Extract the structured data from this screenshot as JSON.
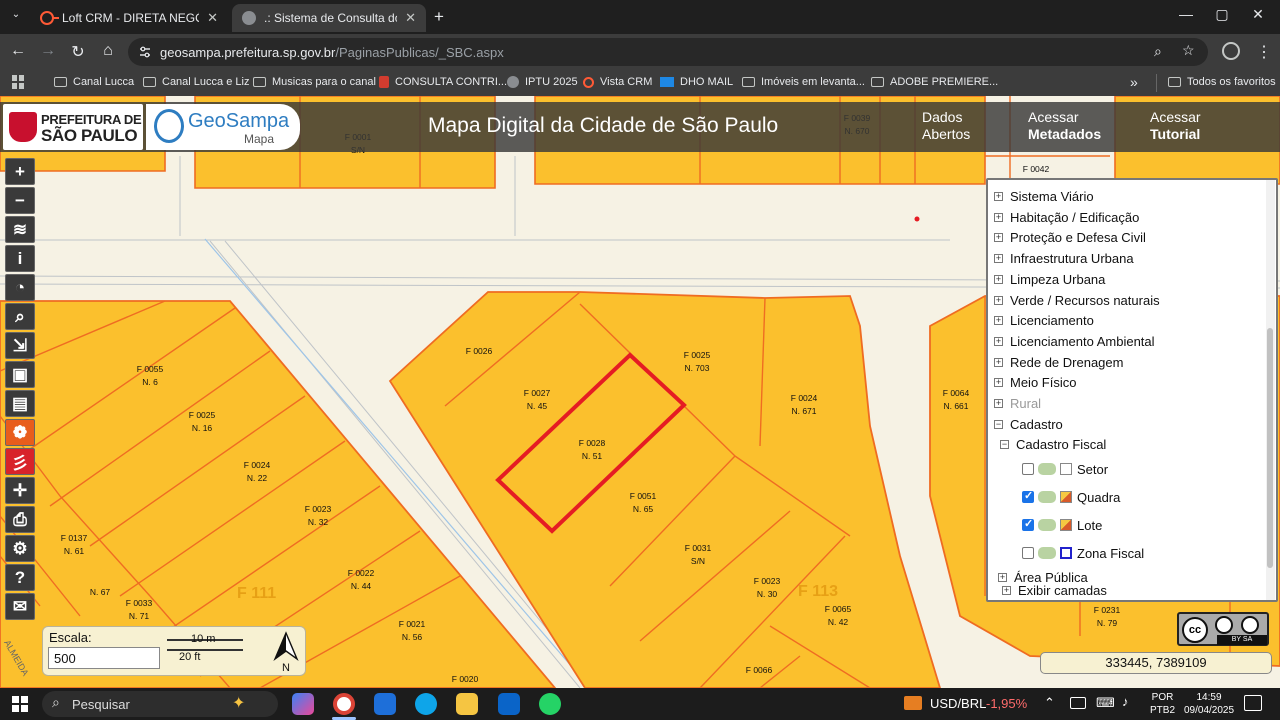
{
  "browser": {
    "tabs": [
      {
        "title": "Loft CRM - DIRETA NEGÓCIOS I",
        "active": false
      },
      {
        "title": ".: Sistema de Consulta do Mapa",
        "active": true
      }
    ],
    "new_tab": "+",
    "url_host": "geosampa.prefeitura.sp.gov.br",
    "url_path": "/PaginasPublicas/_SBC.aspx",
    "bookmarks": [
      {
        "label": "Canal Lucca",
        "icon": "folder-icon"
      },
      {
        "label": "Canal Lucca e Liz",
        "icon": "folder-icon"
      },
      {
        "label": "Musicas para o canal",
        "icon": "folder-icon"
      },
      {
        "label": "CONSULTA CONTRI...",
        "icon": "bookmark-icon"
      },
      {
        "label": "IPTU 2025",
        "icon": "globe-icon"
      },
      {
        "label": "Vista CRM",
        "icon": "loft-icon"
      },
      {
        "label": "DHO MAIL",
        "icon": "mail-icon"
      },
      {
        "label": "Imóveis em levanta...",
        "icon": "folder-icon"
      },
      {
        "label": "ADOBE PREMIERE...",
        "icon": "folder-icon"
      }
    ],
    "more_bookmarks": "»",
    "all_favorites": "Todos os favoritos"
  },
  "header": {
    "logo_line1": "PREFEITURA DE",
    "logo_line2": "SÃO PAULO",
    "geosampa_name": "GeoSampa",
    "geosampa_sub": "Mapa",
    "title": "Mapa Digital da Cidade de São Paulo",
    "links": [
      {
        "line1": "Dados",
        "line2": "Abertos"
      },
      {
        "line1": "Acessar",
        "line2": "Metadados"
      },
      {
        "line1": "Acessar",
        "line2": "Tutorial"
      }
    ]
  },
  "tools": [
    {
      "name": "zoom-in-button",
      "glyph": "+"
    },
    {
      "name": "zoom-out-button",
      "glyph": "−"
    },
    {
      "name": "layers-button",
      "glyph": "≋"
    },
    {
      "name": "info-button",
      "glyph": "i"
    },
    {
      "name": "measure-button",
      "glyph": "◔"
    },
    {
      "name": "search-button",
      "glyph": "⌕"
    },
    {
      "name": "select-button",
      "glyph": "⇲"
    },
    {
      "name": "save-button",
      "glyph": "▣"
    },
    {
      "name": "ruler-button",
      "glyph": "▤"
    },
    {
      "name": "palette-button",
      "glyph": "❁"
    },
    {
      "name": "draw-button",
      "glyph": "彡"
    },
    {
      "name": "pan-button",
      "glyph": "✛"
    },
    {
      "name": "print-button",
      "glyph": "⎙"
    },
    {
      "name": "settings-button",
      "glyph": "⚙"
    },
    {
      "name": "help-button",
      "glyph": "?"
    },
    {
      "name": "email-button",
      "glyph": "✉"
    }
  ],
  "map": {
    "lot_labels": [
      {
        "code": "F 0001",
        "num": "S/N"
      },
      {
        "code": "F 0026",
        "num": ""
      },
      {
        "code": "F 0025",
        "num": "N. 703"
      },
      {
        "code": "F 0027",
        "num": "N. 45"
      },
      {
        "code": "F 0028",
        "num": "N. 51"
      },
      {
        "code": "F 0024",
        "num": "N. 671"
      },
      {
        "code": "F 0051",
        "num": "N. 65"
      },
      {
        "code": "F 0031",
        "num": "S/N"
      },
      {
        "code": "F 0023",
        "num": "N. 30"
      },
      {
        "code": "F 0065",
        "num": "N. 42"
      },
      {
        "code": "F 0066",
        "num": ""
      },
      {
        "code": "F 0055",
        "num": "N. 6"
      },
      {
        "code": "F 0025",
        "num": "N. 16"
      },
      {
        "code": "F 0024",
        "num": "N. 22"
      },
      {
        "code": "F 0023",
        "num": "N. 32"
      },
      {
        "code": "F 0022",
        "num": "N. 44"
      },
      {
        "code": "F 0021",
        "num": "N. 56"
      },
      {
        "code": "F 0020",
        "num": ""
      },
      {
        "code": "F 0137",
        "num": "N. 61"
      },
      {
        "code": "F 0033",
        "num": "N. 71"
      },
      {
        "code": "",
        "num": "N. 67"
      },
      {
        "code": "F 0064",
        "num": "N. 661"
      },
      {
        "code": "F 0231",
        "num": "N. 79"
      },
      {
        "code": "F 0042",
        "num": ""
      },
      {
        "code": "F 0039",
        "num": "N. 670"
      }
    ],
    "quadra_labels": [
      "F 111",
      "F 113"
    ],
    "street_label": "ALMEIDA"
  },
  "layer_panel": {
    "items": [
      {
        "label": "Sistema Viário",
        "type": "group",
        "expanded": false
      },
      {
        "label": "Habitação / Edificação",
        "type": "group",
        "expanded": false
      },
      {
        "label": "Proteção e Defesa Civil",
        "type": "group",
        "expanded": false
      },
      {
        "label": "Infraestrutura Urbana",
        "type": "group",
        "expanded": false
      },
      {
        "label": "Limpeza Urbana",
        "type": "group",
        "expanded": false
      },
      {
        "label": "Verde / Recursos naturais",
        "type": "group",
        "expanded": false
      },
      {
        "label": "Licenciamento",
        "type": "group",
        "expanded": false
      },
      {
        "label": "Licenciamento Ambiental",
        "type": "group",
        "expanded": false
      },
      {
        "label": "Rede de Drenagem",
        "type": "group",
        "expanded": false
      },
      {
        "label": "Meio Físico",
        "type": "group",
        "expanded": false
      },
      {
        "label": "Rural",
        "type": "group",
        "expanded": false
      },
      {
        "label": "Cadastro",
        "type": "group",
        "expanded": true
      },
      {
        "label": "Cadastro Fiscal",
        "type": "subgroup",
        "expanded": true
      },
      {
        "label": "Setor",
        "type": "layer",
        "checked": false,
        "symbol": "empty"
      },
      {
        "label": "Quadra",
        "type": "layer",
        "checked": true,
        "symbol": "quadra"
      },
      {
        "label": "Lote",
        "type": "layer",
        "checked": true,
        "symbol": "lote"
      },
      {
        "label": "Zona Fiscal",
        "type": "layer",
        "checked": false,
        "symbol": "zona"
      },
      {
        "label": "Área Pública",
        "type": "group",
        "expanded": false
      }
    ],
    "footer": "Exibir camadas"
  },
  "scale": {
    "label": "Escala:",
    "value": "500",
    "metric": "10 m",
    "imperial": "20 ft",
    "north": "N"
  },
  "license": {
    "line": "BY  SA"
  },
  "coordinates": "333445, 7389109",
  "taskbar": {
    "search": "Pesquisar",
    "currency": "USD/BRL",
    "change": "-1,95%",
    "lang1": "POR",
    "lang2": "PTB2",
    "time": "14:59",
    "date": "09/04/2025"
  },
  "colors": {
    "lot_fill": "#fbc02d",
    "lot_edge": "#ef6c22",
    "selection": "#e51c23",
    "street": "#f6f2e4"
  }
}
